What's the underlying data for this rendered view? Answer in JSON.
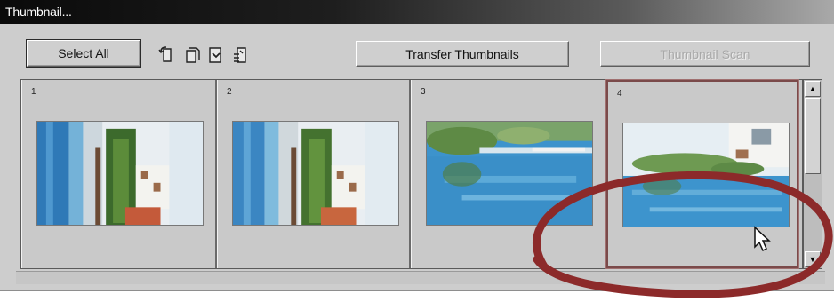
{
  "window": {
    "title": "Thumbnail..."
  },
  "toolbar": {
    "select_all_label": "Select All",
    "transfer_label": "Transfer Thumbnails",
    "scan_label": "Thumbnail Scan",
    "icons": [
      "rotate-left-icon",
      "rotate-right-icon",
      "flip-icon",
      "mirror-icon"
    ]
  },
  "thumbnails": [
    {
      "number": "1",
      "image": "pool-portrait-rotated",
      "selected": false
    },
    {
      "number": "2",
      "image": "pool-portrait-rotated",
      "selected": false
    },
    {
      "number": "3",
      "image": "pool-landscape",
      "selected": false
    },
    {
      "number": "4",
      "image": "pool-landscape-buildings",
      "selected": true
    }
  ],
  "colors": {
    "window_bg": "#cdcdcd",
    "annotation_circle": "#8c2a2a",
    "selection_border": "#7a4a4a"
  }
}
